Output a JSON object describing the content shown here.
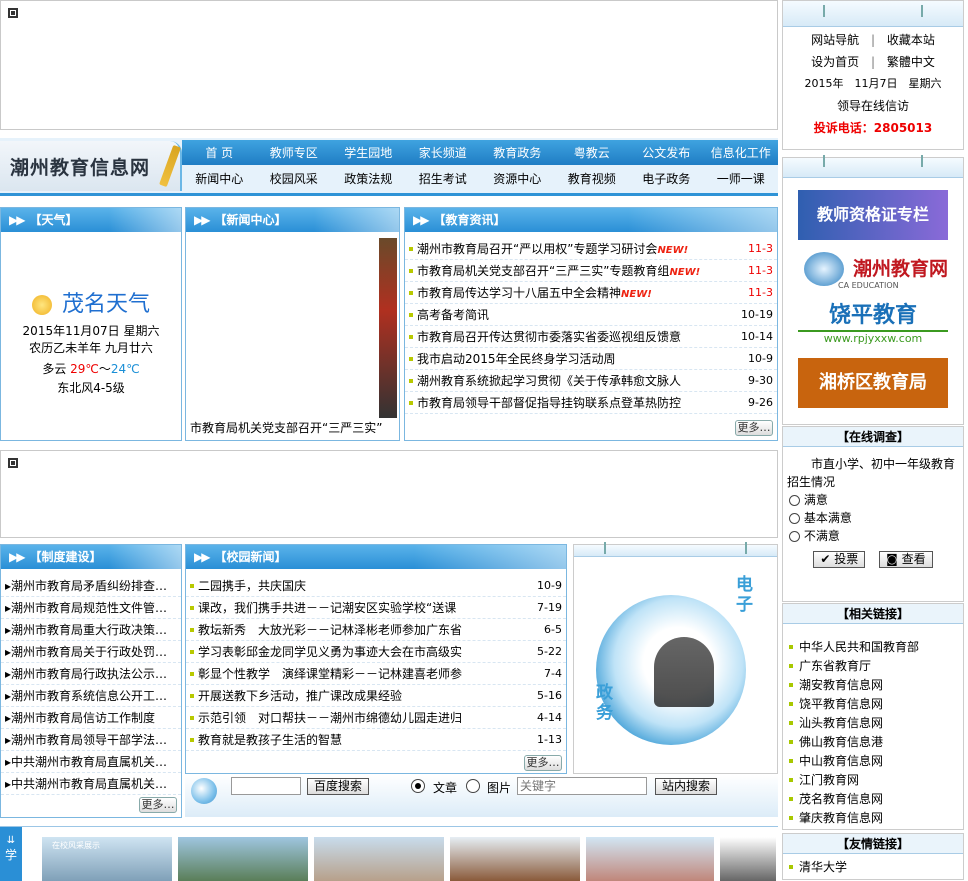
{
  "nav": {
    "logo": "潮州教育信息网",
    "row1": [
      "首 页",
      "教师专区",
      "学生园地",
      "家长频道",
      "教育政务",
      "粤教云",
      "公文发布",
      "信息化工作"
    ],
    "row2": [
      "新闻中心",
      "校园风采",
      "政策法规",
      "招生考试",
      "资源中心",
      "教育视频",
      "电子政务",
      "一师一课"
    ]
  },
  "weather": {
    "title": "【天气】",
    "city": "茂名天气",
    "date": "2015年11月07日 星期六",
    "lunar": "农历乙未羊年 九月廿六",
    "cond": "多云",
    "temp_hi": "29℃",
    "temp_sep": "～",
    "temp_lo": "24℃",
    "wind": "东北风4-5级"
  },
  "news_center": {
    "title": "【新闻中心】",
    "caption": "市教育局机关党支部召开“三严三实”"
  },
  "edu_info": {
    "title": "【教育资讯】",
    "more": "更多…",
    "items": [
      {
        "text": "潮州市教育局召开“严以用权”专题学习研讨会",
        "new": "NEW!",
        "date": "11-3",
        "red": true
      },
      {
        "text": "市教育局机关党支部召开“三严三实”专题教育组",
        "new": "NEW!",
        "date": "11-3",
        "red": true
      },
      {
        "text": "市教育局传达学习十八届五中全会精神",
        "new": "NEW!",
        "date": "11-3",
        "red": true
      },
      {
        "text": "高考备考简讯",
        "new": "",
        "date": "10-19",
        "red": false
      },
      {
        "text": "市教育局召开传达贯彻市委落实省委巡视组反馈意",
        "new": "",
        "date": "10-14",
        "red": false
      },
      {
        "text": "我市启动2015年全民终身学习活动周",
        "new": "",
        "date": "10-9",
        "red": false
      },
      {
        "text": "潮州教育系统掀起学习贯彻《关于传承韩愈文脉人",
        "new": "",
        "date": "9-30",
        "red": false
      },
      {
        "text": "市教育局领导干部督促指导挂钩联系点登革热防控",
        "new": "",
        "date": "9-26",
        "red": false
      }
    ]
  },
  "system": {
    "title": "【制度建设】",
    "more": "更多…",
    "items": [
      "潮州市教育局矛盾纠纷排查…",
      "潮州市教育局规范性文件管…",
      "潮州市教育局重大行政决策…",
      "潮州市教育局关于行政处罚…",
      "潮州市教育局行政执法公示…",
      "潮州市教育系统信息公开工…",
      "潮州市教育局信访工作制度",
      "潮州市教育局领导干部学法…",
      "中共潮州市教育局直属机关…",
      "中共潮州市教育局直属机关…"
    ]
  },
  "campus": {
    "title": "【校园新闻】",
    "more": "更多…",
    "items": [
      {
        "text": "二园携手，共庆国庆",
        "date": "10-9"
      },
      {
        "text": "课改，我们携手共进－－记潮安区实验学校“送课",
        "date": "7-19"
      },
      {
        "text": "教坛新秀　大放光彩－－记林泽彬老师参加广东省",
        "date": "6-5"
      },
      {
        "text": "学习表彰邱金龙同学见义勇为事迹大会在市高级实",
        "date": "5-22"
      },
      {
        "text": "彰显个性教学　演绎课堂精彩－－记林建喜老师参",
        "date": "7-4"
      },
      {
        "text": "开展送教下乡活动，推广课改成果经验",
        "date": "5-16"
      },
      {
        "text": "示范引领　对口帮扶－－潮州市绵德幼儿园走进归",
        "date": "4-14"
      },
      {
        "text": "教育就是教孩子生活的智慧",
        "date": "1-13"
      }
    ]
  },
  "egov": {
    "label1": "电子",
    "label2": "政务"
  },
  "search": {
    "baidu_btn": "百度搜索",
    "opt1": "文章",
    "opt2": "图片",
    "keyword_placeholder": "关键字",
    "site_btn": "站内搜索"
  },
  "school_strip": {
    "label": "学",
    "banner": "在校风采展示"
  },
  "top_right": {
    "link1": "网站导航",
    "link2": "收藏本站",
    "link3": "设为首页",
    "link4": "繁體中文",
    "sep": "|",
    "date": "2015年　11月7日　星期六",
    "letter": "领导在线信访",
    "phone": "投诉电话：2805013"
  },
  "ads": {
    "a1": "教师资格证专栏",
    "a2": "潮州教育网",
    "a2_sub": "CA EDUCATION",
    "a3": "饶平教育",
    "a3_url": "www.rpjyxxw.com",
    "a4": "湘桥区教育局"
  },
  "survey": {
    "title": "【在线调查】",
    "question": "市直小学、初中一年级教育招生情况",
    "options": [
      "满意",
      "基本满意",
      "不满意"
    ],
    "vote": "投票",
    "view": "查看"
  },
  "related": {
    "title": "【相关链接】",
    "items": [
      "中华人民共和国教育部",
      "广东省教育厅",
      "潮安教育信息网",
      "饶平教育信息网",
      "汕头教育信息网",
      "佛山教育信息港",
      "中山教育信息网",
      "江门教育网",
      "茂名教育信息网",
      "肇庆教育信息网"
    ]
  },
  "friends": {
    "title": "【友情链接】",
    "items": [
      "清华大学"
    ]
  },
  "colors": {
    "nav_blue": "#2a8fd6",
    "red": "#e00000",
    "accent_green": "#b8c900"
  }
}
